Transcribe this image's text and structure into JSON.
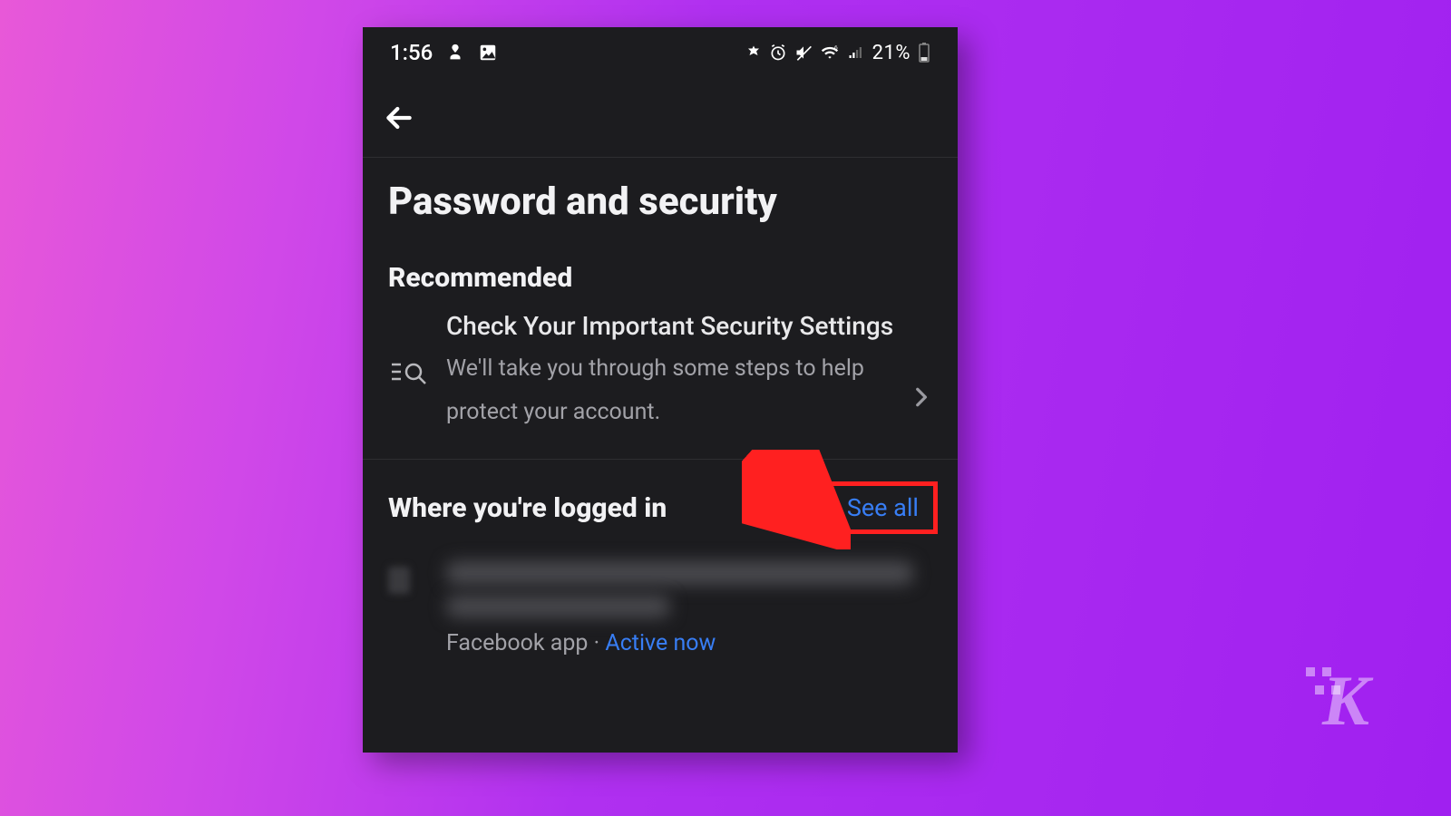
{
  "status_bar": {
    "time": "1:56",
    "battery_text": "21%"
  },
  "page": {
    "title": "Password and security"
  },
  "recommended": {
    "heading": "Recommended",
    "item": {
      "title": "Check Your Important Security Settings",
      "subtitle": "We'll take you through some steps to help protect your account."
    }
  },
  "logged_in": {
    "heading": "Where you're logged in",
    "see_all": "See all",
    "entry": {
      "app_label": "Facebook app",
      "separator": " · ",
      "status": "Active now"
    }
  },
  "watermark": "K",
  "colors": {
    "link": "#387ef5",
    "annotation": "#ff2020"
  }
}
